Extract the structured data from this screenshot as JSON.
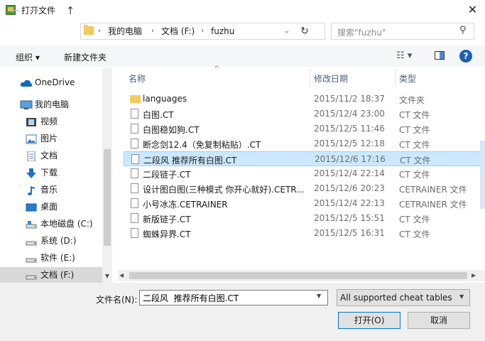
{
  "window": {
    "title": "打开文件",
    "close": "✕"
  },
  "nav": {
    "back": "←",
    "forward": "→",
    "recent": "⌄",
    "up": "↑",
    "breadcrumb": [
      "我的电脑",
      "文档 (F:)",
      "fuzhu"
    ],
    "dropdown": "⌄",
    "refresh": "↻",
    "search_placeholder": "搜索\"fuzhu\"",
    "search_icon": "⚲"
  },
  "toolbar": {
    "organize": "组织 ▾",
    "new_folder": "新建文件夹",
    "view": "☷ ▾",
    "help": "?"
  },
  "sidebar": {
    "items": [
      {
        "label": "OneDrive",
        "icon": "cloud-icon"
      },
      {
        "label": "我的电脑",
        "icon": "computer-icon"
      },
      {
        "label": "视频",
        "icon": "video-icon"
      },
      {
        "label": "图片",
        "icon": "picture-icon"
      },
      {
        "label": "文档",
        "icon": "document-icon"
      },
      {
        "label": "下载",
        "icon": "download-icon"
      },
      {
        "label": "音乐",
        "icon": "music-icon"
      },
      {
        "label": "桌面",
        "icon": "desktop-icon"
      },
      {
        "label": "本地磁盘 (C:)",
        "icon": "drive-icon"
      },
      {
        "label": "系统 (D:)",
        "icon": "drive-icon"
      },
      {
        "label": "软件 (E:)",
        "icon": "drive-icon"
      },
      {
        "label": "文档 (F:)",
        "icon": "drive-icon"
      }
    ],
    "scroll_down": "▼"
  },
  "columns": {
    "name": "名称",
    "date": "修改日期",
    "type": "类型",
    "sort": "^"
  },
  "files": [
    {
      "name": "languages",
      "date": "2015/11/2 18:37",
      "type": "文件夹",
      "kind": "folder"
    },
    {
      "name": "白图.CT",
      "date": "2015/12/4 23:00",
      "type": "CT 文件",
      "kind": "file"
    },
    {
      "name": "白图稳如狗.CT",
      "date": "2015/12/5 11:46",
      "type": "CT 文件",
      "kind": "file"
    },
    {
      "name": "断念剑12.4（免复制粘贴）.CT",
      "date": "2015/12/5 12:18",
      "type": "CT 文件",
      "kind": "file"
    },
    {
      "name": "二段风  推荐所有白图.CT",
      "date": "2015/12/6 17:16",
      "type": "CT 文件",
      "kind": "file"
    },
    {
      "name": "二段链子.CT",
      "date": "2015/12/4 22:14",
      "type": "CT 文件",
      "kind": "file"
    },
    {
      "name": "设计图白图(三种模式 你开心就好).CETR...",
      "date": "2015/12/6 20:23",
      "type": "CETRAINER 文件",
      "kind": "file"
    },
    {
      "name": "小号冰冻.CETRAINER",
      "date": "2015/12/4 22:13",
      "type": "CETRAINER 文件",
      "kind": "file"
    },
    {
      "name": "新版链子.CT",
      "date": "2015/12/5 15:51",
      "type": "CT 文件",
      "kind": "file"
    },
    {
      "name": "蜘蛛异界.CT",
      "date": "2015/12/5 16:31",
      "type": "CT 文件",
      "kind": "file"
    }
  ],
  "selected_index": 4,
  "hscroll": {
    "left": "◀",
    "right": "▶"
  },
  "bottom": {
    "filename_label": "文件名(N):",
    "filename_value": "二段风  推荐所有白图.CT",
    "filename_dd": "▼",
    "filter": "All supported cheat tables",
    "filter_dd": "▼",
    "open": "打开(O)",
    "cancel": "取消"
  }
}
